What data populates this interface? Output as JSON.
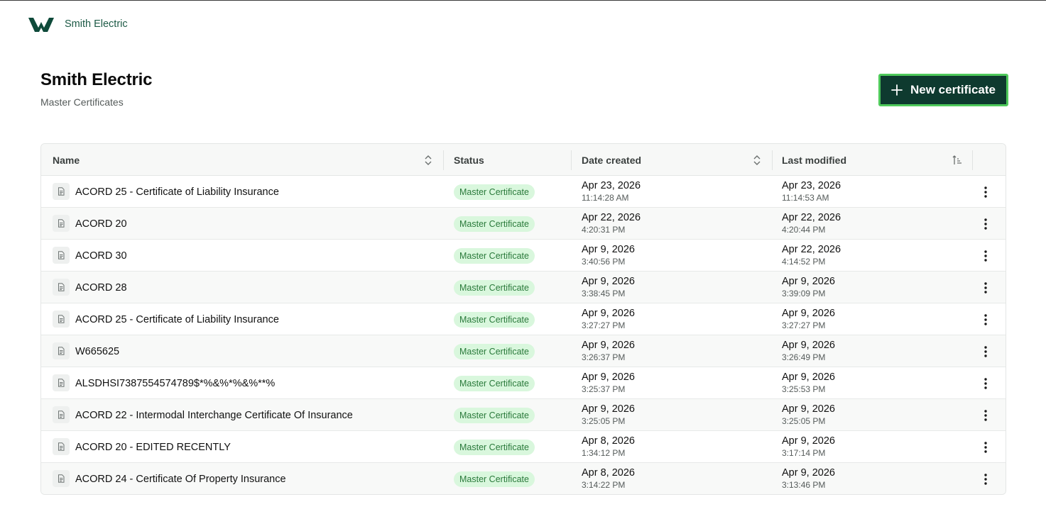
{
  "header": {
    "brand": "Smith Electric",
    "logo_icon": "brand-logo-icon"
  },
  "page": {
    "title": "Smith Electric",
    "subtitle": "Master Certificates",
    "new_button_label": "New certificate"
  },
  "colors": {
    "accent": "#0e3a2f",
    "focus_ring": "#4fc95b",
    "badge_bg": "#d9f7dd",
    "badge_text": "#2a7a3b"
  },
  "table": {
    "columns": {
      "name": "Name",
      "status": "Status",
      "created": "Date created",
      "modified": "Last modified"
    },
    "rows": [
      {
        "name": "ACORD 25 - Certificate of Liability Insurance",
        "status": "Master Certificate",
        "created_date": "Apr 23, 2026",
        "created_time": "11:14:28 AM",
        "modified_date": "Apr 23, 2026",
        "modified_time": "11:14:53 AM"
      },
      {
        "name": "ACORD 20",
        "status": "Master Certificate",
        "created_date": "Apr 22, 2026",
        "created_time": "4:20:31 PM",
        "modified_date": "Apr 22, 2026",
        "modified_time": "4:20:44 PM"
      },
      {
        "name": "ACORD 30",
        "status": "Master Certificate",
        "created_date": "Apr 9, 2026",
        "created_time": "3:40:56 PM",
        "modified_date": "Apr 22, 2026",
        "modified_time": "4:14:52 PM"
      },
      {
        "name": "ACORD 28",
        "status": "Master Certificate",
        "created_date": "Apr 9, 2026",
        "created_time": "3:38:45 PM",
        "modified_date": "Apr 9, 2026",
        "modified_time": "3:39:09 PM"
      },
      {
        "name": "ACORD 25 - Certificate of Liability Insurance",
        "status": "Master Certificate",
        "created_date": "Apr 9, 2026",
        "created_time": "3:27:27 PM",
        "modified_date": "Apr 9, 2026",
        "modified_time": "3:27:27 PM"
      },
      {
        "name": "W665625",
        "status": "Master Certificate",
        "created_date": "Apr 9, 2026",
        "created_time": "3:26:37 PM",
        "modified_date": "Apr 9, 2026",
        "modified_time": "3:26:49 PM"
      },
      {
        "name": "ALSDHSI7387554574789$*%&%*%&%**%",
        "status": "Master Certificate",
        "created_date": "Apr 9, 2026",
        "created_time": "3:25:37 PM",
        "modified_date": "Apr 9, 2026",
        "modified_time": "3:25:53 PM"
      },
      {
        "name": "ACORD 22 - Intermodal Interchange Certificate Of Insurance",
        "status": "Master Certificate",
        "created_date": "Apr 9, 2026",
        "created_time": "3:25:05 PM",
        "modified_date": "Apr 9, 2026",
        "modified_time": "3:25:05 PM"
      },
      {
        "name": "ACORD 20 - EDITED RECENTLY",
        "status": "Master Certificate",
        "created_date": "Apr 8, 2026",
        "created_time": "1:34:12 PM",
        "modified_date": "Apr 9, 2026",
        "modified_time": "3:17:14 PM"
      },
      {
        "name": "ACORD 24 - Certificate Of Property Insurance",
        "status": "Master Certificate",
        "created_date": "Apr 8, 2026",
        "created_time": "3:14:22 PM",
        "modified_date": "Apr 9, 2026",
        "modified_time": "3:13:46 PM"
      }
    ]
  }
}
